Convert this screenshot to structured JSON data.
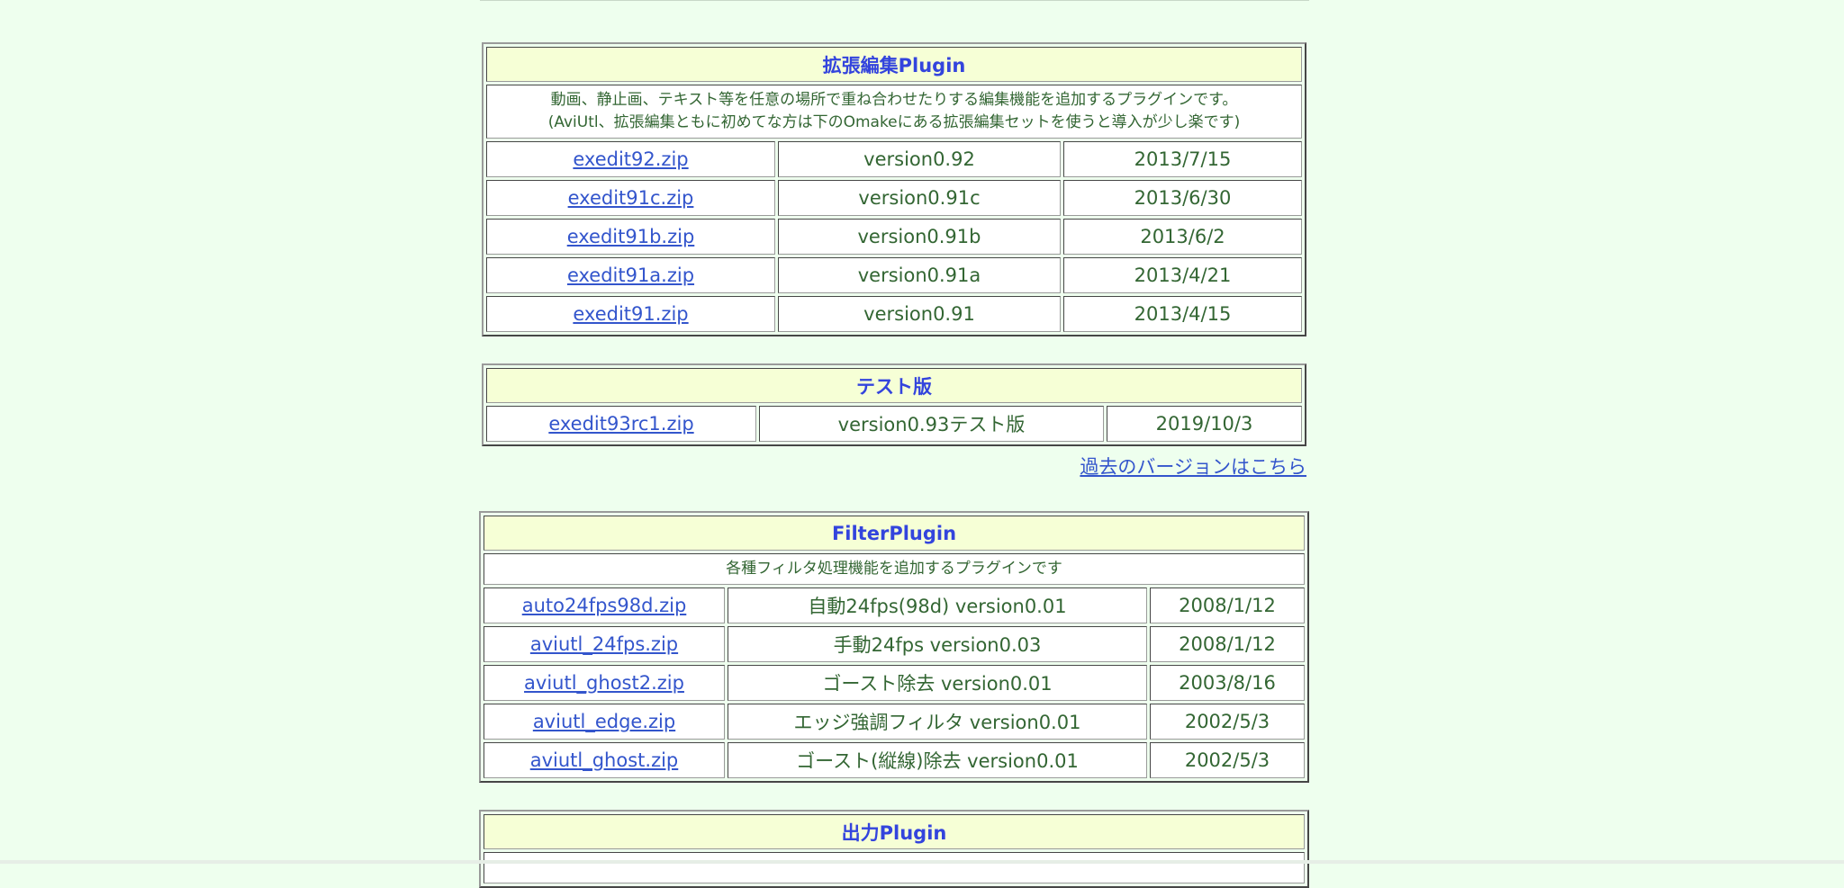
{
  "exedit": {
    "title": "拡張編集Plugin",
    "description_line1": "動画、静止画、テキスト等を任意の場所で重ね合わせたりする編集機能を追加するプラグインです。",
    "description_line2": "(AviUtl、拡張編集ともに初めてな方は下のOmakeにある拡張編集セットを使うと導入が少し楽です)",
    "rows": [
      {
        "file": "exedit92.zip",
        "version": "version0.92",
        "date": "2013/7/15"
      },
      {
        "file": "exedit91c.zip",
        "version": "version0.91c",
        "date": "2013/6/30"
      },
      {
        "file": "exedit91b.zip",
        "version": "version0.91b",
        "date": "2013/6/2"
      },
      {
        "file": "exedit91a.zip",
        "version": "version0.91a",
        "date": "2013/4/21"
      },
      {
        "file": "exedit91.zip",
        "version": "version0.91",
        "date": "2013/4/15"
      }
    ]
  },
  "test": {
    "title": "テスト版",
    "rows": [
      {
        "file": "exedit93rc1.zip",
        "version": "version0.93テスト版",
        "date": "2019/10/3"
      }
    ]
  },
  "past_versions_link": "過去のバージョンはこちら",
  "filter": {
    "title": "FilterPlugin",
    "description": "各種フィルタ処理機能を追加するプラグインです",
    "rows": [
      {
        "file": "auto24fps98d.zip",
        "version": "自動24fps(98d) version0.01",
        "date": "2008/1/12"
      },
      {
        "file": "aviutl_24fps.zip",
        "version": "手動24fps version0.03",
        "date": "2008/1/12"
      },
      {
        "file": "aviutl_ghost2.zip",
        "version": "ゴースト除去 version0.01",
        "date": "2003/8/16"
      },
      {
        "file": "aviutl_edge.zip",
        "version": "エッジ強調フィルタ version0.01",
        "date": "2002/5/3"
      },
      {
        "file": "aviutl_ghost.zip",
        "version": "ゴースト(縦線)除去 version0.01",
        "date": "2002/5/3"
      }
    ]
  },
  "output": {
    "title": "出力Plugin"
  },
  "colors": {
    "background": "#eeffee",
    "header_background": "#f6ffd6",
    "header_text": "#3344dd",
    "link": "#3355cc",
    "body_text": "#336633"
  }
}
